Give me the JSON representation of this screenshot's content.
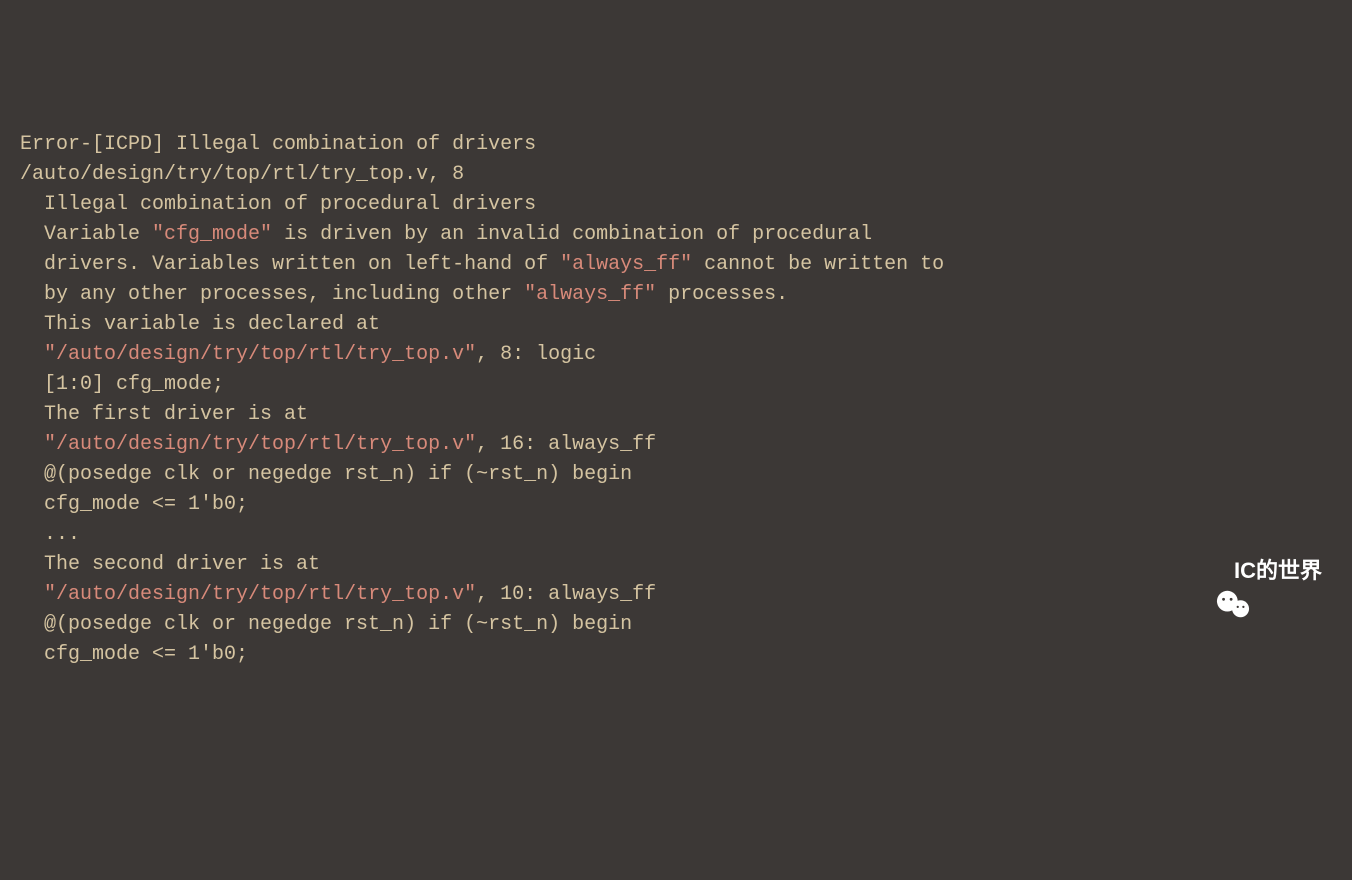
{
  "terminal": {
    "lines": [
      {
        "segments": [
          {
            "text": "Error-[ICPD] Illegal combination of drivers",
            "class": ""
          }
        ]
      },
      {
        "segments": [
          {
            "text": "/auto/design/try/top/rtl/try_top.v, 8",
            "class": ""
          }
        ]
      },
      {
        "segments": [
          {
            "text": "  Illegal combination of procedural drivers",
            "class": ""
          }
        ]
      },
      {
        "segments": [
          {
            "text": "  Variable ",
            "class": ""
          },
          {
            "text": "\"cfg_mode\"",
            "class": "hl"
          },
          {
            "text": " is driven by an invalid combination of procedural",
            "class": ""
          }
        ]
      },
      {
        "segments": [
          {
            "text": "  drivers. Variables written on left-hand of ",
            "class": ""
          },
          {
            "text": "\"always_ff\"",
            "class": "hl"
          },
          {
            "text": " cannot be written to",
            "class": ""
          }
        ]
      },
      {
        "segments": [
          {
            "text": "  by any other processes, including other ",
            "class": ""
          },
          {
            "text": "\"always_ff\"",
            "class": "hl"
          },
          {
            "text": " processes.",
            "class": ""
          }
        ]
      },
      {
        "segments": [
          {
            "text": "  This variable is declared at",
            "class": ""
          }
        ]
      },
      {
        "segments": [
          {
            "text": "  ",
            "class": ""
          },
          {
            "text": "\"/auto/design/try/top/rtl/try_top.v\"",
            "class": "hl"
          },
          {
            "text": ", 8: logic",
            "class": ""
          }
        ]
      },
      {
        "segments": [
          {
            "text": "  [1:0] cfg_mode;",
            "class": ""
          }
        ]
      },
      {
        "segments": [
          {
            "text": "  The first driver is at",
            "class": ""
          }
        ]
      },
      {
        "segments": [
          {
            "text": "  ",
            "class": ""
          },
          {
            "text": "\"/auto/design/try/top/rtl/try_top.v\"",
            "class": "hl"
          },
          {
            "text": ", 16: always_ff",
            "class": ""
          }
        ]
      },
      {
        "segments": [
          {
            "text": "  @(posedge clk or negedge rst_n) if (~rst_n) begin",
            "class": ""
          }
        ]
      },
      {
        "segments": [
          {
            "text": "  cfg_mode <= 1'b0;",
            "class": ""
          }
        ]
      },
      {
        "segments": [
          {
            "text": "  ...",
            "class": ""
          }
        ]
      },
      {
        "segments": [
          {
            "text": "  The second driver is at",
            "class": ""
          }
        ]
      },
      {
        "segments": [
          {
            "text": "  ",
            "class": ""
          },
          {
            "text": "\"/auto/design/try/top/rtl/try_top.v\"",
            "class": "hl"
          },
          {
            "text": ", 10: always_ff",
            "class": ""
          }
        ]
      },
      {
        "segments": [
          {
            "text": "  @(posedge clk or negedge rst_n) if (~rst_n) begin",
            "class": ""
          }
        ]
      },
      {
        "segments": [
          {
            "text": "  cfg_mode <= 1'b0;",
            "class": ""
          }
        ]
      }
    ]
  },
  "watermark": {
    "label": "IC的世界"
  }
}
